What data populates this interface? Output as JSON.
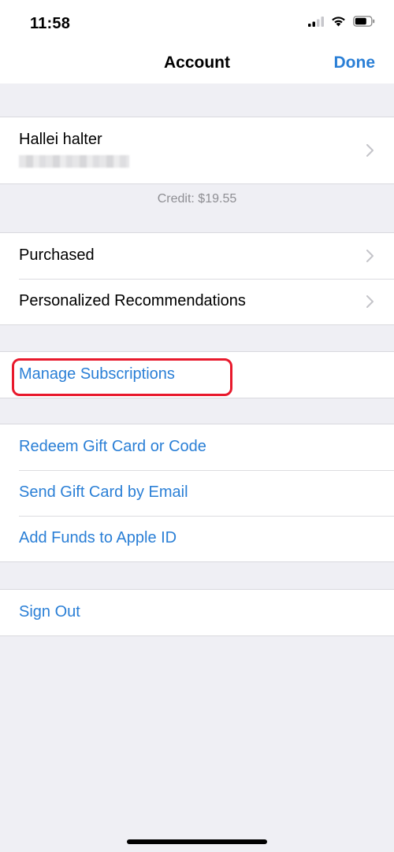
{
  "status_bar": {
    "time": "11:58",
    "icons": [
      "cellular-signal-icon",
      "wifi-icon",
      "battery-icon"
    ]
  },
  "nav": {
    "title": "Account",
    "done_label": "Done"
  },
  "account": {
    "name": "Hallei halter",
    "credit": "Credit: $19.55"
  },
  "menu": {
    "purchased": "Purchased",
    "personalized": "Personalized Recommendations",
    "manage_subscriptions": "Manage Subscriptions",
    "redeem": "Redeem Gift Card or Code",
    "send_gift": "Send Gift Card by Email",
    "add_funds": "Add Funds to Apple ID",
    "sign_out": "Sign Out"
  },
  "colors": {
    "accent": "#2a7fd6",
    "highlight": "#e8192c",
    "background": "#efeff4"
  }
}
